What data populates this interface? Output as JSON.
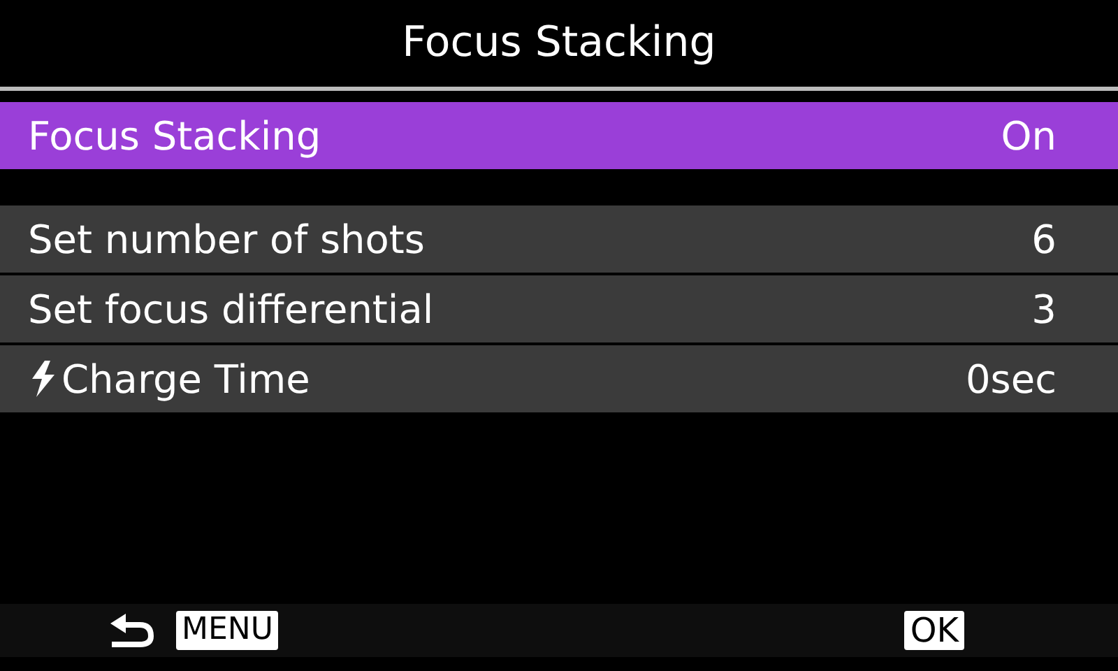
{
  "title": "Focus Stacking",
  "sections": [
    {
      "items": [
        {
          "kind": "setting",
          "label": "Focus Stacking",
          "value": "On",
          "selected": true
        }
      ]
    },
    {
      "items": [
        {
          "kind": "setting",
          "label": "Set number of shots",
          "value": "6",
          "selected": false
        },
        {
          "kind": "setting",
          "label": "Set focus differential",
          "value": "3",
          "selected": false
        },
        {
          "kind": "flash-setting",
          "label": "Charge Time",
          "value": "0sec",
          "selected": false
        }
      ]
    }
  ],
  "footer": {
    "back_key": "MENU",
    "ok_key": "OK"
  }
}
